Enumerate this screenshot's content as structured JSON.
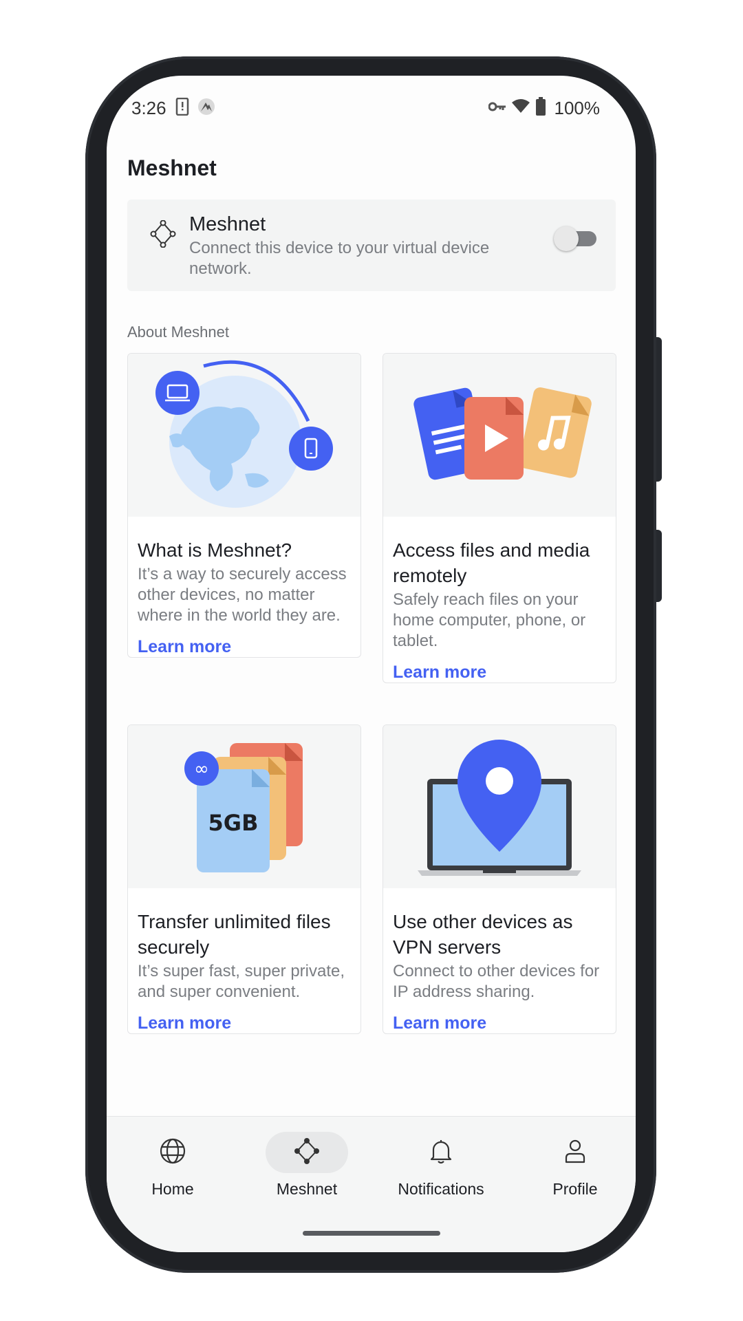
{
  "status_bar": {
    "time": "3:26",
    "battery": "100%"
  },
  "page": {
    "title": "Meshnet"
  },
  "meshnet_toggle": {
    "title": "Meshnet",
    "subtitle": "Connect this device to your virtual device network.",
    "enabled": false
  },
  "section": {
    "label": "About Meshnet"
  },
  "cards": [
    {
      "title": "What is Meshnet?",
      "description": "It’s a way to securely access other devices, no matter where in the world they are.",
      "link": "Learn more"
    },
    {
      "title": "Access files and media remotely",
      "description": "Safely reach files on your home computer, phone, or tablet.",
      "link": "Learn more"
    },
    {
      "title": "Transfer unlimited files securely",
      "description": "It’s super fast, super private, and super convenient.",
      "link": "Learn more",
      "illustration_text": "5GB"
    },
    {
      "title": "Use other devices as VPN servers",
      "description": "Connect to other devices for IP address sharing.",
      "link": "Learn more"
    }
  ],
  "bottom_nav": {
    "items": [
      {
        "label": "Home",
        "icon": "globe-icon"
      },
      {
        "label": "Meshnet",
        "icon": "meshnet-icon",
        "active": true
      },
      {
        "label": "Notifications",
        "icon": "bell-icon"
      },
      {
        "label": "Profile",
        "icon": "profile-icon"
      }
    ]
  },
  "colors": {
    "accent": "#4461f2",
    "card_bg": "#f3f4f4"
  }
}
